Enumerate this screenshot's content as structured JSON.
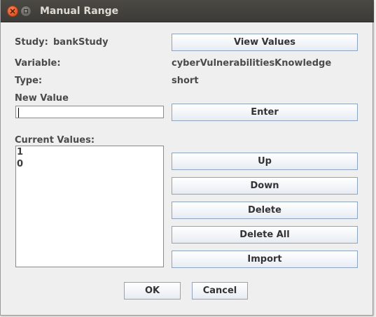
{
  "window": {
    "title": "Manual Range"
  },
  "form": {
    "study_label": "Study:",
    "study_value": "bankStudy",
    "variable_label": "Variable:",
    "variable_value": "cyberVulnerabilitiesKnowledge",
    "type_label": "Type:",
    "type_value": "short",
    "new_value_label": "New Value",
    "new_value_input": "",
    "current_values_label": "Current Values:",
    "current_values": [
      "1",
      "0"
    ]
  },
  "buttons": {
    "view_values": "View Values",
    "enter": "Enter",
    "up": "Up",
    "down": "Down",
    "delete": "Delete",
    "delete_all": "Delete All",
    "import": "Import",
    "ok": "OK",
    "cancel": "Cancel"
  },
  "colors": {
    "titlebar": "#3c3b37",
    "close_button": "#e55b2c",
    "button_border": "#8ea3bd"
  }
}
